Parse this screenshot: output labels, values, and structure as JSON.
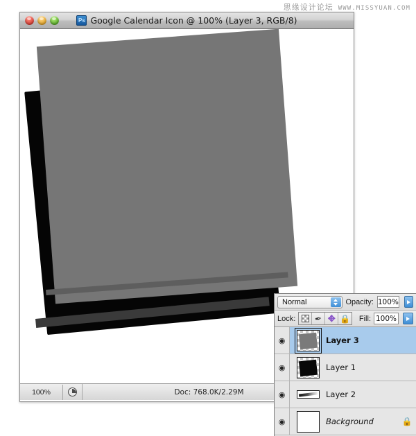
{
  "watermark": {
    "chinese": "思缘设计论坛",
    "url": "WWW.MISSYUAN.COM"
  },
  "document_window": {
    "title": "Google Calendar Icon @ 100% (Layer 3, RGB/8)",
    "app_icon": "photoshop-icon",
    "app_icon_label": "Ps",
    "traffic_lights": [
      {
        "name": "close-button",
        "color": "#e0443a"
      },
      {
        "name": "minimize-button",
        "color": "#e8a92d"
      },
      {
        "name": "zoom-button",
        "color": "#5fb22d"
      }
    ],
    "status_bar": {
      "zoom": "100%",
      "timing_icon": "pie-chart-icon",
      "doc_info": "Doc: 768.0K/2.29M",
      "menu_arrow_icon": "triangle-right-icon"
    },
    "canvas": {
      "background": "#ffffff",
      "shapes": [
        {
          "name": "black-card",
          "color": "#050505",
          "rotation": "-5.4deg"
        },
        {
          "name": "black-card-edge",
          "color": "#3a3a3a",
          "rotation": "-5.4deg"
        },
        {
          "name": "gray-card",
          "color": "#767676",
          "rotation": "-4.2deg"
        },
        {
          "name": "gray-card-edge",
          "color": "#5e5e5e",
          "rotation": "-4.2deg"
        }
      ]
    }
  },
  "layers_panel": {
    "blend_mode": "Normal",
    "opacity_label": "Opacity:",
    "opacity_value": "100%",
    "lock_label": "Lock:",
    "fill_label": "Fill:",
    "fill_value": "100%",
    "lock_buttons": [
      {
        "name": "lock-transparent-pixels",
        "icon": "checkerboard-icon"
      },
      {
        "name": "lock-image-pixels",
        "icon": "brush-icon",
        "glyph": "✎"
      },
      {
        "name": "lock-position",
        "icon": "move-cross-icon",
        "glyph": "✥"
      },
      {
        "name": "lock-all",
        "icon": "padlock-icon",
        "glyph": "🔒"
      }
    ],
    "eye_icon_glyph": "◉",
    "layers": [
      {
        "name": "Layer 3",
        "selected": true,
        "visible": true,
        "thumb": "gray-rotated-square",
        "locked": false,
        "italic": false
      },
      {
        "name": "Layer 1",
        "selected": false,
        "visible": true,
        "thumb": "black-rotated-square",
        "locked": false,
        "italic": false
      },
      {
        "name": "Layer 2",
        "selected": false,
        "visible": true,
        "thumb": "thin-streak",
        "locked": false,
        "italic": false
      },
      {
        "name": "Background",
        "selected": false,
        "visible": true,
        "thumb": "white-solid",
        "locked": true,
        "italic": true
      }
    ]
  },
  "colors": {
    "selection_blue": "#a8cbec",
    "panel_gray": "#e3e3e3",
    "artwork_gray": "#767676",
    "artwork_black": "#050505"
  }
}
